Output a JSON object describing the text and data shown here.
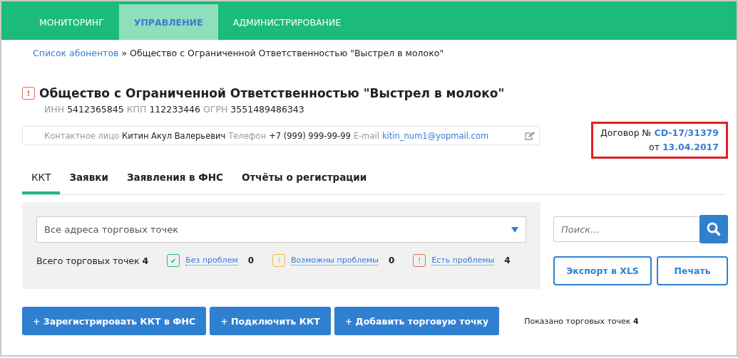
{
  "nav": [
    {
      "label": "МОНИТОРИНГ",
      "selected": false
    },
    {
      "label": "УПРАВЛЕНИЕ",
      "selected": true
    },
    {
      "label": "АДМИНИСТРИРОВАНИЕ",
      "selected": false
    }
  ],
  "breadcrumb": {
    "link": "Список абонентов",
    "separator": "»",
    "current": "Общество с Ограниченной Ответственностью \"Выстрел в молоко\""
  },
  "company": {
    "alert_icon": "!",
    "name": "Общество с Ограниченной Ответственностью \"Выстрел в молоко\"",
    "ids": [
      {
        "label": "ИНН",
        "value": "5412365845"
      },
      {
        "label": "КПП",
        "value": "112233446"
      },
      {
        "label": "ОГРН",
        "value": "3551489486343"
      }
    ]
  },
  "contact": [
    {
      "label": "Контактное лицо",
      "value": "Китин Акул Валерьевич",
      "link": false
    },
    {
      "label": "Телефон",
      "value": "+7 (999) 999-99-99",
      "link": false
    },
    {
      "label": "E-mail",
      "value": "kitin_num1@yopmail.com",
      "link": true
    }
  ],
  "contract": {
    "label": "Договор №",
    "number": "CD-17/31379",
    "date_label": "от",
    "date": "13.04.2017",
    "highlighted": true
  },
  "tabs": [
    {
      "label": "ККТ",
      "selected": true
    },
    {
      "label": "Заявки",
      "selected": false
    },
    {
      "label": "Заявления в ФНС",
      "selected": false
    },
    {
      "label": "Отчёты о регистрации",
      "selected": false
    }
  ],
  "filter": {
    "select_value": "Все адреса торговых точек",
    "total_label": "Всего торговых точек",
    "total": "4",
    "statuses": [
      {
        "icon": "✔",
        "label": "Без проблем",
        "count": "0",
        "color": "#1dbb7b"
      },
      {
        "icon": "?",
        "label": "Возможны проблемы",
        "count": "0",
        "color": "#f5b945"
      },
      {
        "icon": "!",
        "label": "Есть проблемы",
        "count": "4",
        "color": "#e06c5a"
      }
    ]
  },
  "search": {
    "placeholder": "Поиск..."
  },
  "side_buttons": [
    "Экспорт в XLS",
    "Печать"
  ],
  "actions": [
    "+ Зарегистрировать ККТ в ФНС",
    "+ Подключить ККТ",
    "+ Добавить торговую точку"
  ],
  "shown": {
    "label": "Показано торговых точек",
    "count": "4"
  }
}
